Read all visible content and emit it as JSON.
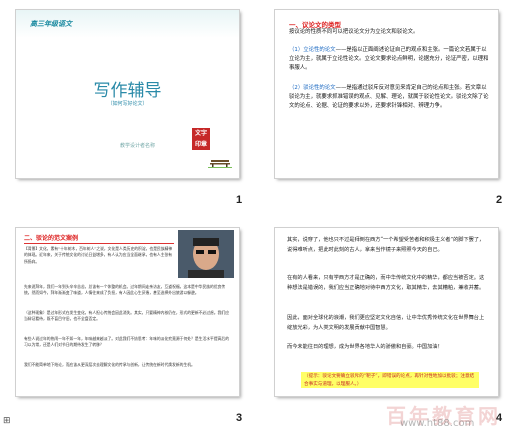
{
  "slide_numbers": [
    "1",
    "2",
    "3",
    "4"
  ],
  "slide1": {
    "subject": "高三年级语文",
    "title": "写作辅导",
    "paren": "（如何写好论文）",
    "author": "教学设计者名称",
    "seal_text": "文字印章"
  },
  "slide2": {
    "heading": "一、议论文的类型",
    "intro": "按议论的性质不同可以把议论文分为立论文和驳论文。",
    "p1_label": "（1）立论性的论文",
    "p1_rest": "——是指以正面阐述论证自己的观点和主张。一篇论文若属于以立论为主，就属于立论性论文。立论文要求论点鲜明，论据充分，论证严密，以理和事服人。",
    "p2_label": "（2）驳论性的论文",
    "p2_rest": "——是指通过驳斥反对意见来肯定自己的论点和主张。若文章以驳论为主，就要求抓准错误的观点、见解、理论，就属于驳论性论文。驳论文除了论文的论点、论据、论证的要求以外，还要求针锋相对、辨理力争。"
  },
  "slide3": {
    "heading": "二、驳论的范文案例",
    "intro": "【背景】文化，素有“十年树木，百年树人”之说，文化是人类历史的积淀，也是民族精神的体现。近年来，关于传统文化的讨论日益增多，有人认为应当全面继承，也有人主张有所扬弃。",
    "para1": "先来说拜年，我们一年到头辛辛苦苦，总该有一个休整的机会。过年期间走亲访友，互道祝福，这本是中华民族的优良传统。然而如今，拜年渐渐变了味道，人情往来成了负担，有人因此心生厌倦，甚至选择外出旅游以躲避。",
    "para2": "（这种现象）是过年形式在发生变化，有人担心传统会因此消失。其实，只要精神内核仍在，形式的更新不必过虑。我们应当辩证看待，既不盲目守旧，也不全盘否定。",
    "para3": "有些人说过年的热闹一年不如一年，年味越来越淡了。对此我们不妨思考：年味的淡化究竟源于何处？是生活水平提高后的习以为常，还是人们对节日的期待发生了转移？",
    "para4": "我们不能简单地下结论，而应该从更深层次去理解文化的传承与创新，让传统在新时代焕发新的生机。"
  },
  "slide4": {
    "p1": "其实，说穿了，他也只不过是拜倒在西方“一个希望受苦者和积极主义者”的脚下罢了，说得难听点，把此时此刻的古人，拿来当作镜子来照照今天的自己。",
    "p2": "在有的人看来，只有学西方才是正确的，而中华传统文化中的精华，都应当被否定。这种想法是错误的，我们应当正确地对待中西方文化，取其精华，去其糟粕，兼收并蓄。",
    "p3": "因此，面对全球化的浪潮，我们更应坚定文化自信，让中华优秀传统文化在世界舞台上绽放光彩，为人类文明的发展贡献中国智慧。",
    "p4": "而今未能往日的理想，成为世界各地华人的骄傲和自豪。中国加油！",
    "note": "（提示：驳论文要确立驳斥的“靶子”，即错误的论点，再针对性地加以批驳；注意结合事实与道理，以理服人。）"
  },
  "watermark": {
    "brand": "百年教育网",
    "url": "www.ht88.com"
  },
  "colors": {
    "accent_blue": "#2a8aa8",
    "heading_red": "#d22222",
    "highlight": "#ffff00"
  }
}
